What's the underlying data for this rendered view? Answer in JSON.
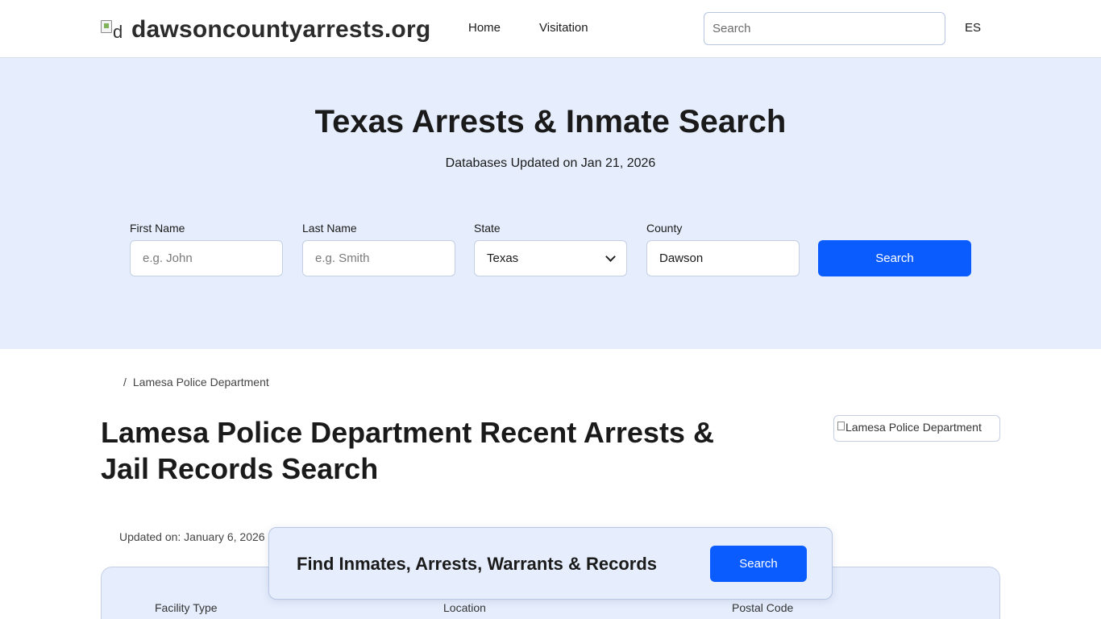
{
  "header": {
    "logo_alt": "d",
    "site_name": "dawsoncountyarrests.org",
    "nav": [
      {
        "label": "Home"
      },
      {
        "label": "Visitation"
      }
    ],
    "search_placeholder": "Search",
    "language": "ES"
  },
  "hero": {
    "title": "Texas Arrests & Inmate Search",
    "subtitle": "Databases Updated on Jan 21, 2026",
    "fields": {
      "first_name": {
        "label": "First Name",
        "placeholder": "e.g. John"
      },
      "last_name": {
        "label": "Last Name",
        "placeholder": "e.g. Smith"
      },
      "state": {
        "label": "State",
        "value": "Texas"
      },
      "county": {
        "label": "County",
        "value": "Dawson"
      }
    },
    "search_label": "Search"
  },
  "breadcrumb": {
    "separator": "/",
    "current": "Lamesa Police Department"
  },
  "main": {
    "title": "Lamesa Police Department Recent Arrests & Jail Records Search",
    "image_alt": "Lamesa Police Department",
    "updated": "Updated on: January 6, 2026",
    "info_labels": [
      "Facility Type",
      "Location",
      "Postal Code"
    ]
  },
  "float_bar": {
    "text": "Find Inmates, Arrests, Warrants & Records",
    "button": "Search"
  },
  "colors": {
    "accent": "#0b5cff",
    "hero_bg": "#e6eefd",
    "border": "#c4cfe3"
  }
}
